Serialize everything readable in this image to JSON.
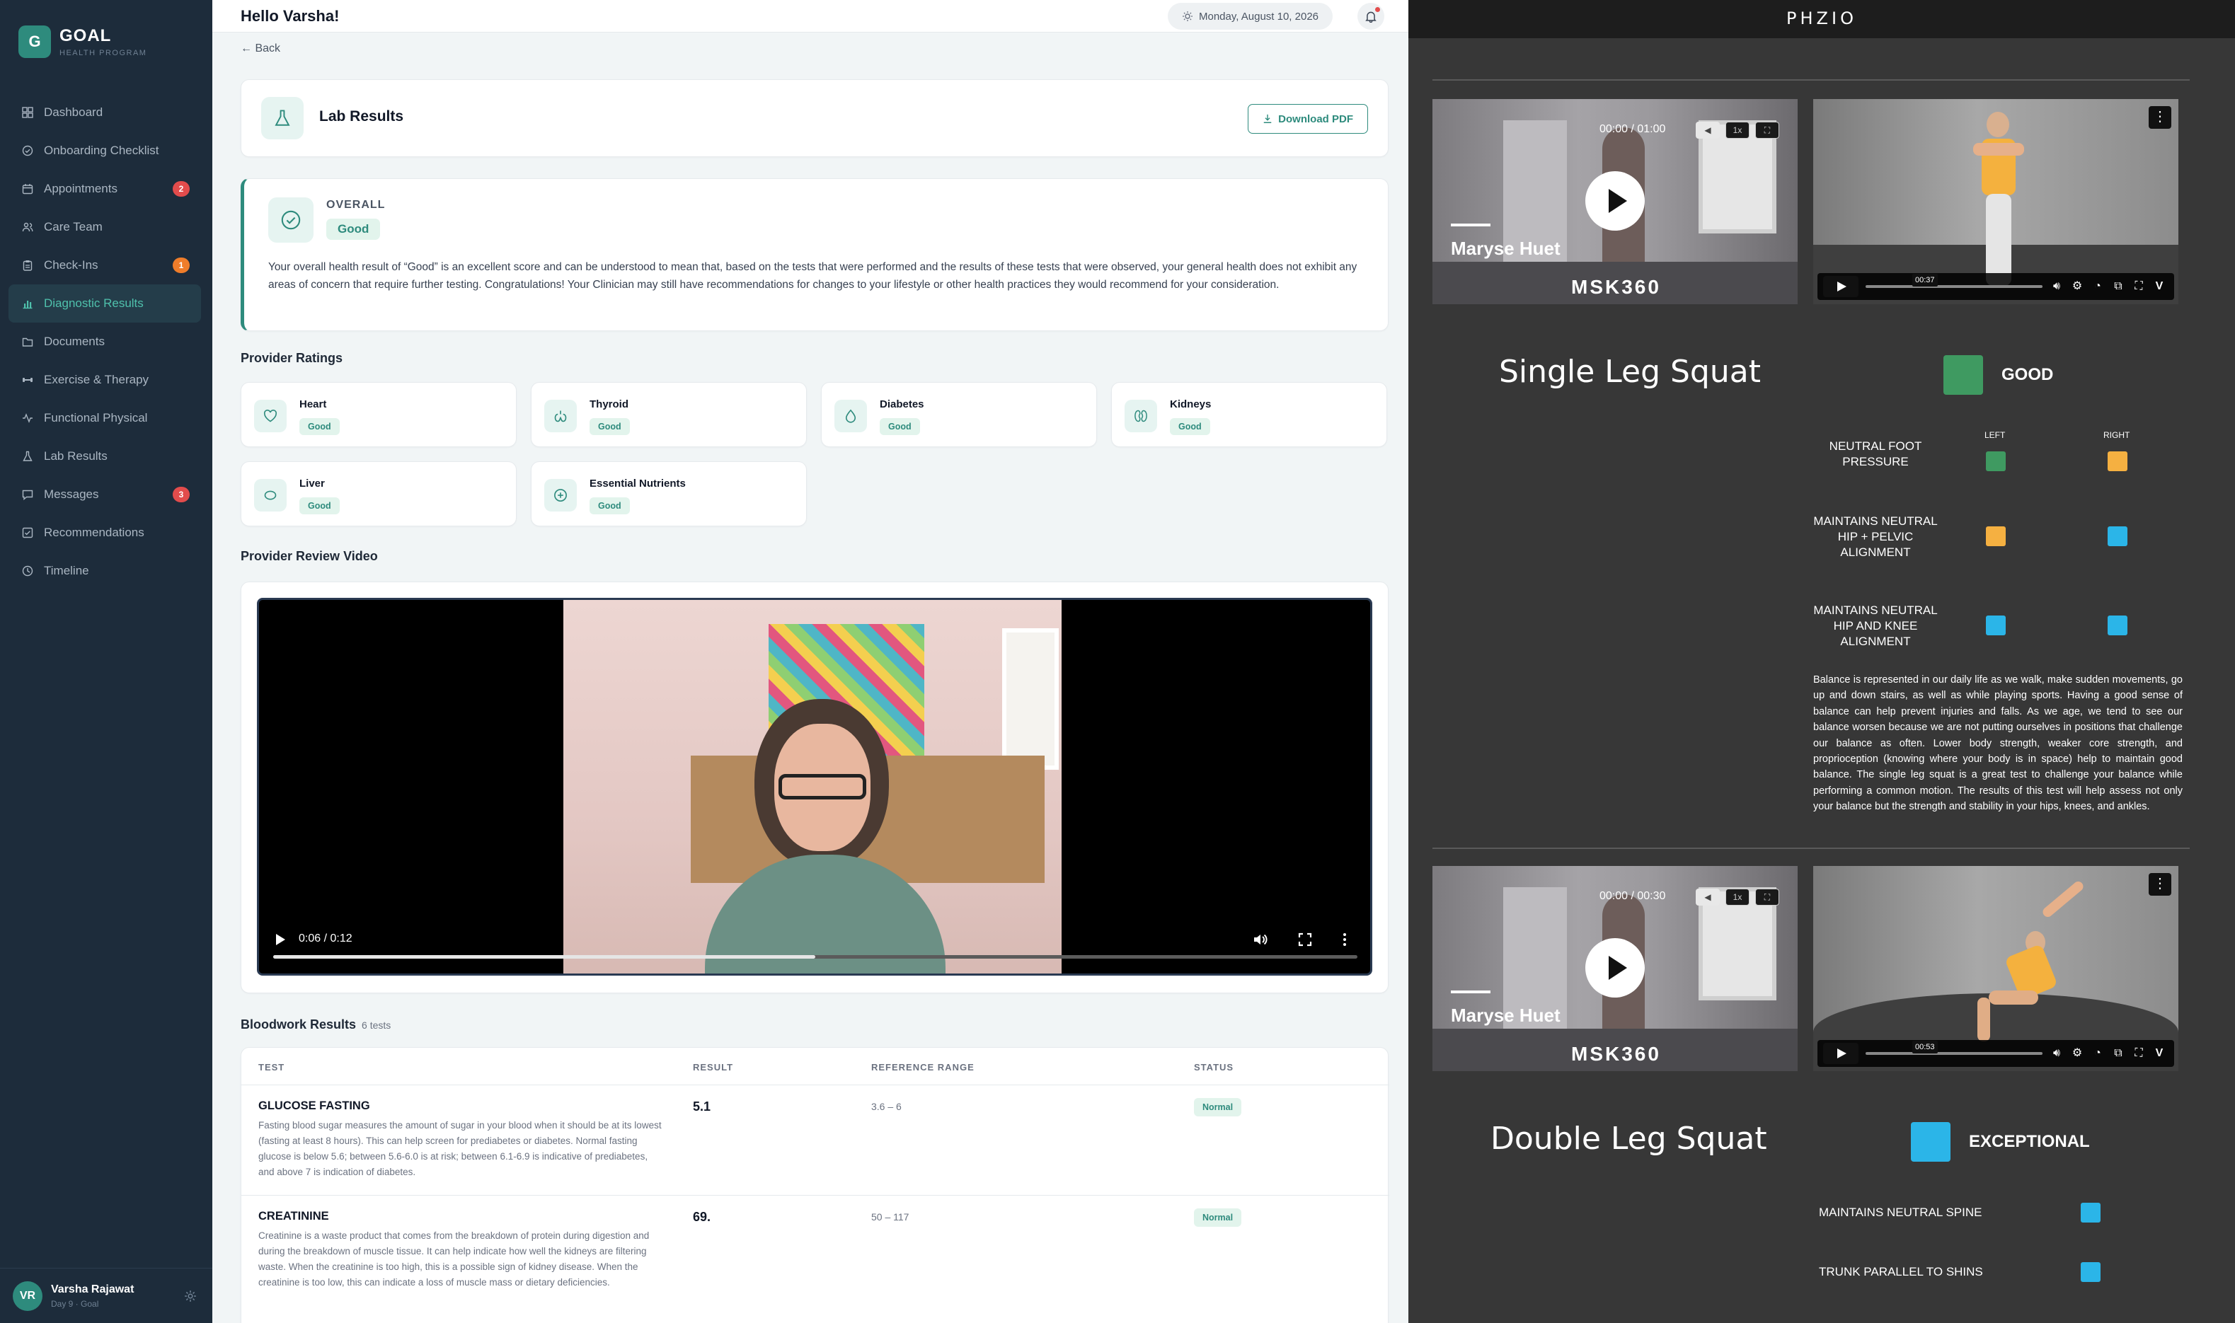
{
  "sidebar": {
    "logo_letter": "G",
    "brand": "GOAL",
    "brand_sub": "HEALTH PROGRAM",
    "items": [
      {
        "label": "Dashboard",
        "icon": "grid-icon"
      },
      {
        "label": "Onboarding Checklist",
        "icon": "check-circle-icon"
      },
      {
        "label": "Appointments",
        "icon": "calendar-icon",
        "badge": "2"
      },
      {
        "label": "Care Team",
        "icon": "users-icon"
      },
      {
        "label": "Check-Ins",
        "icon": "clipboard-icon",
        "badge": "1"
      },
      {
        "label": "Diagnostic Results",
        "icon": "bar-chart-icon",
        "active": true
      },
      {
        "label": "Documents",
        "icon": "folder-icon"
      },
      {
        "label": "Exercise & Therapy",
        "icon": "dumbbell-icon"
      },
      {
        "label": "Functional Physical",
        "icon": "activity-icon"
      },
      {
        "label": "Lab Results",
        "icon": "flask-icon"
      },
      {
        "label": "Messages",
        "icon": "message-icon",
        "badge": "3"
      },
      {
        "label": "Recommendations",
        "icon": "checklist-icon"
      },
      {
        "label": "Timeline",
        "icon": "clock-icon"
      }
    ],
    "user": {
      "initials": "VR",
      "name": "Varsha Rajawat",
      "sub": "Day 9 · Goal"
    }
  },
  "header": {
    "greeting": "Hello Varsha!",
    "date": "Monday, August 10, 2026"
  },
  "main": {
    "back": "← Back",
    "lab_title": "Lab Results",
    "download_label": "Download PDF",
    "overall": {
      "label": "OVERALL",
      "badge": "Good",
      "text": "Your overall health result of “Good” is an excellent score and can be understood to mean that, based on the tests that were performed and the results of these tests that were observed, your general health does not exhibit any areas of concern that require further testing. Congratulations! Your Clinician may still have recommendations for changes to your lifestyle or other health practices they would recommend for your consideration."
    },
    "provider_ratings_title": "Provider Ratings",
    "ratings": [
      {
        "name": "Heart",
        "status": "Good"
      },
      {
        "name": "Thyroid",
        "status": "Good"
      },
      {
        "name": "Diabetes",
        "status": "Good"
      },
      {
        "name": "Kidneys",
        "status": "Good"
      },
      {
        "name": "Liver",
        "status": "Good"
      },
      {
        "name": "Essential Nutrients",
        "status": "Good"
      }
    ],
    "video_title": "Provider Review Video",
    "video": {
      "time": "0:06 / 0:12",
      "progress": 0.5
    },
    "bloodwork": {
      "title": "Bloodwork Results",
      "count": "6 tests",
      "headers": [
        "TEST",
        "RESULT",
        "REFERENCE RANGE",
        "STATUS"
      ],
      "rows": [
        {
          "name": "GLUCOSE FASTING",
          "desc": "Fasting blood sugar measures the amount of sugar in your blood when it should be at its lowest (fasting at least 8 hours). This can help screen for prediabetes or diabetes. Normal fasting glucose is below 5.6; between 5.6-6.0 is at risk; between 6.1-6.9 is indicative of prediabetes, and above 7 is indication of diabetes.",
          "result": "5.1",
          "range": "3.6 – 6",
          "status": "Normal"
        },
        {
          "name": "CREATININE",
          "desc": "Creatinine is a waste product that comes from the breakdown of protein during digestion and during the breakdown of muscle tissue. It can help indicate how well the kidneys are filtering waste. When the creatinine is too high, this is a possible sign of kidney disease. When the creatinine is too low, this can indicate a loss of muscle mass or dietary deficiencies.",
          "result": "69.",
          "range": "50 – 117",
          "status": "Normal"
        }
      ]
    }
  },
  "panel": {
    "logo": "PHZIO",
    "colors": {
      "good": "#3f9a61",
      "warning": "#f5b041",
      "exceptional": "#2bb5e8"
    },
    "video1": {
      "time": "00:00 / 01:00",
      "speed": "1x",
      "name": "Maryse Huet",
      "brand": "MSK360",
      "vimeo_time": "00:37"
    },
    "exercise1": {
      "title": "Single Leg Squat",
      "grade": "GOOD",
      "grade_color": "good",
      "left_label": "LEFT",
      "right_label": "RIGHT",
      "criteria": [
        {
          "label": "NEUTRAL FOOT PRESSURE",
          "left": "good",
          "right": "warning"
        },
        {
          "label": "MAINTAINS NEUTRAL HIP + PELVIC ALIGNMENT",
          "left": "warning",
          "right": "exceptional"
        },
        {
          "label": "MAINTAINS NEUTRAL HIP AND KNEE ALIGNMENT",
          "left": "exceptional",
          "right": "exceptional"
        }
      ],
      "description": "Balance is represented in our daily life as we walk, make sudden movements, go up and down stairs, as well as while playing sports.  Having a good sense of balance can help prevent injuries and falls.  As we age, we tend to see our balance worsen because we are not putting ourselves in positions that challenge our balance as often.  Lower body strength, weaker core strength, and proprioception (knowing where your body is in space) help to maintain good balance. The single leg squat is a great test to challenge your balance while performing a common motion.  The results of this test will help assess not only your balance but the strength and stability in your hips, knees, and ankles."
    },
    "video2": {
      "time": "00:00 / 00:30",
      "speed": "1x",
      "name": "Maryse Huet",
      "brand": "MSK360",
      "vimeo_time": "00:53"
    },
    "exercise2": {
      "title": "Double Leg Squat",
      "grade": "EXCEPTIONAL",
      "grade_color": "exceptional",
      "criteria": [
        {
          "label": "MAINTAINS NEUTRAL SPINE",
          "value": "exceptional"
        },
        {
          "label": "TRUNK PARALLEL TO SHINS",
          "value": "exceptional"
        }
      ]
    }
  }
}
